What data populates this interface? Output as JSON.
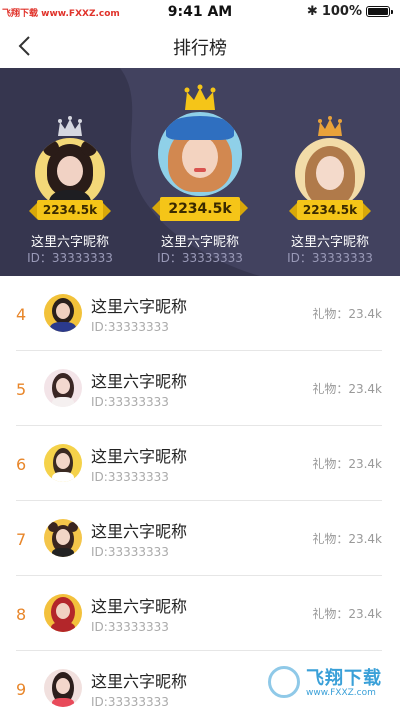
{
  "status_bar": {
    "watermark": "飞翔下载 www.FXXZ.com",
    "time": "9:41 AM",
    "battery": "100%",
    "battery_level": 1.0
  },
  "nav": {
    "title": "排行榜"
  },
  "top3": [
    {
      "rank": 2,
      "score": "2234.5k",
      "name": "这里六字昵称",
      "id": "ID：33333333",
      "crown_color": "#d6d8e0"
    },
    {
      "rank": 1,
      "score": "2234.5k",
      "name": "这里六字昵称",
      "id": "ID：33333333",
      "crown_color": "#f5c518"
    },
    {
      "rank": 3,
      "score": "2234.5k",
      "name": "这里六字昵称",
      "id": "ID：33333333",
      "crown_color": "#e8a23a"
    }
  ],
  "list": [
    {
      "rank": "4",
      "name": "这里六字昵称",
      "id": "ID:33333333",
      "gift": "礼物：23.4k"
    },
    {
      "rank": "5",
      "name": "这里六字昵称",
      "id": "ID:33333333",
      "gift": "礼物：23.4k"
    },
    {
      "rank": "6",
      "name": "这里六字昵称",
      "id": "ID:33333333",
      "gift": "礼物：23.4k"
    },
    {
      "rank": "7",
      "name": "这里六字昵称",
      "id": "ID:33333333",
      "gift": "礼物：23.4k"
    },
    {
      "rank": "8",
      "name": "这里六字昵称",
      "id": "ID:33333333",
      "gift": "礼物：23.4k"
    },
    {
      "rank": "9",
      "name": "这里六字昵称",
      "id": "ID:33333333",
      "gift": ""
    }
  ],
  "watermark_br": {
    "text": "飞翔下载",
    "url": "www.FXXZ.com"
  },
  "colors": {
    "accent": "#e8862a",
    "podium_bg": "#3a3a55",
    "score_ribbon": "#f5c518"
  }
}
